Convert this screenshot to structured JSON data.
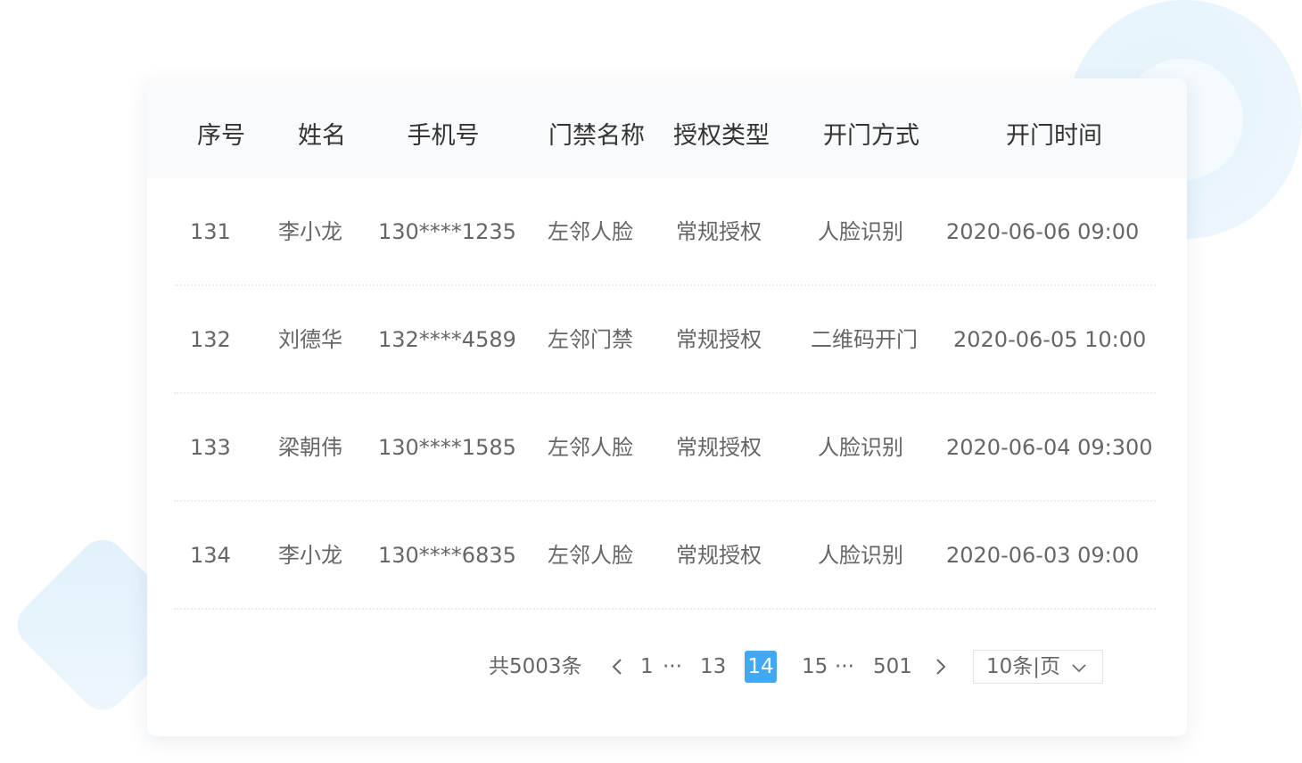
{
  "table": {
    "headers": [
      "序号",
      "姓名",
      "手机号",
      "门禁名称",
      "授权类型",
      "开门方式",
      "开门时间"
    ],
    "rows": [
      [
        "131",
        "李小龙",
        "130****1235",
        "左邻人脸",
        "常规授权",
        "人脸识别",
        "2020-06-06 09:00"
      ],
      [
        "132",
        "刘德华",
        "132****4589",
        "左邻门禁",
        "常规授权",
        "二维码开门",
        "2020-06-05 10:00"
      ],
      [
        "133",
        "梁朝伟",
        "130****1585",
        "左邻人脸",
        "常规授权",
        "人脸识别",
        "2020-06-04 09:300"
      ],
      [
        "134",
        "李小龙",
        "130****6835",
        "左邻人脸",
        "常规授权",
        "人脸识别",
        "2020-06-03 09:00"
      ]
    ]
  },
  "pagination": {
    "total_label": "共5003条",
    "first_page": "1",
    "ellipsis_left": "···",
    "prev_page": "13",
    "current_page": "14",
    "next_page": "15",
    "ellipsis_right": "···",
    "last_page": "501",
    "page_size_label": "10条|页"
  },
  "colors": {
    "accent": "#41a8f3",
    "header_bg": "#f8fafc",
    "text_primary": "#333333",
    "text_secondary": "#666666"
  },
  "icons": {
    "prev": "chevron-left-icon",
    "next": "chevron-right-icon",
    "dropdown": "chevron-down-icon"
  }
}
